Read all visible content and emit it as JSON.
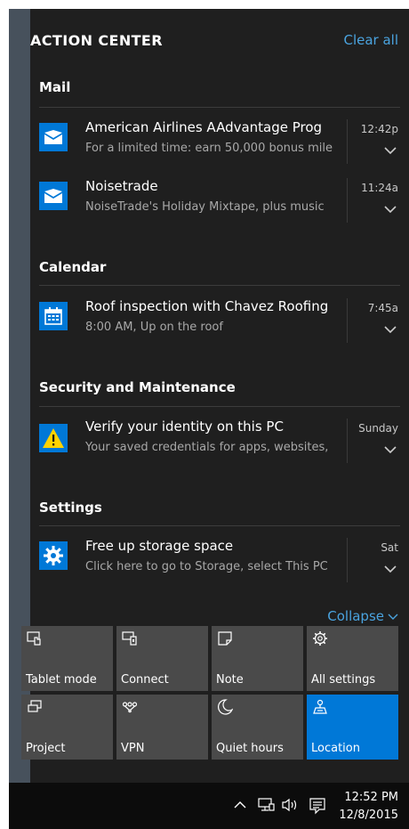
{
  "header": {
    "title": "ACTION CENTER",
    "clear_all": "Clear all"
  },
  "groups": {
    "mail": {
      "title": "Mail",
      "items": [
        {
          "title": "American Airlines AAdvantage Prog",
          "body": "For a limited time: earn 50,000 bonus mile",
          "time": "12:42p",
          "icon": "mail-icon"
        },
        {
          "title": "Noisetrade",
          "body": "NoiseTrade's Holiday Mixtape, plus music",
          "time": "11:24a",
          "icon": "mail-icon"
        }
      ]
    },
    "calendar": {
      "title": "Calendar",
      "items": [
        {
          "title": "Roof inspection with Chavez Roofing",
          "body": "8:00 AM, Up on the roof",
          "time": "7:45a",
          "icon": "calendar-icon"
        }
      ]
    },
    "security": {
      "title": "Security and Maintenance",
      "items": [
        {
          "title": "Verify your identity on this PC",
          "body": "Your saved credentials for apps, websites,",
          "time": "Sunday",
          "icon": "warning-icon"
        }
      ]
    },
    "settings": {
      "title": "Settings",
      "items": [
        {
          "title": "Free up storage space",
          "body": "Click here to go to Storage, select This PC",
          "time": "Sat",
          "icon": "gear-icon"
        }
      ]
    }
  },
  "collapse_label": "Collapse",
  "quick_actions": [
    {
      "label": "Tablet mode",
      "icon": "tablet-mode-icon",
      "active": false
    },
    {
      "label": "Connect",
      "icon": "connect-icon",
      "active": false
    },
    {
      "label": "Note",
      "icon": "note-icon",
      "active": false
    },
    {
      "label": "All settings",
      "icon": "gear-icon",
      "active": false
    },
    {
      "label": "Project",
      "icon": "project-icon",
      "active": false
    },
    {
      "label": "VPN",
      "icon": "vpn-icon",
      "active": false
    },
    {
      "label": "Quiet hours",
      "icon": "moon-icon",
      "active": false
    },
    {
      "label": "Location",
      "icon": "location-icon",
      "active": true
    }
  ],
  "taskbar": {
    "time": "12:52 PM",
    "date": "12/8/2015"
  },
  "colors": {
    "accent": "#0078d7",
    "link": "#4aa3df",
    "panel_bg": "#1f1f1f",
    "tile_bg": "#4a4a4a",
    "warning": "#ffd200"
  }
}
